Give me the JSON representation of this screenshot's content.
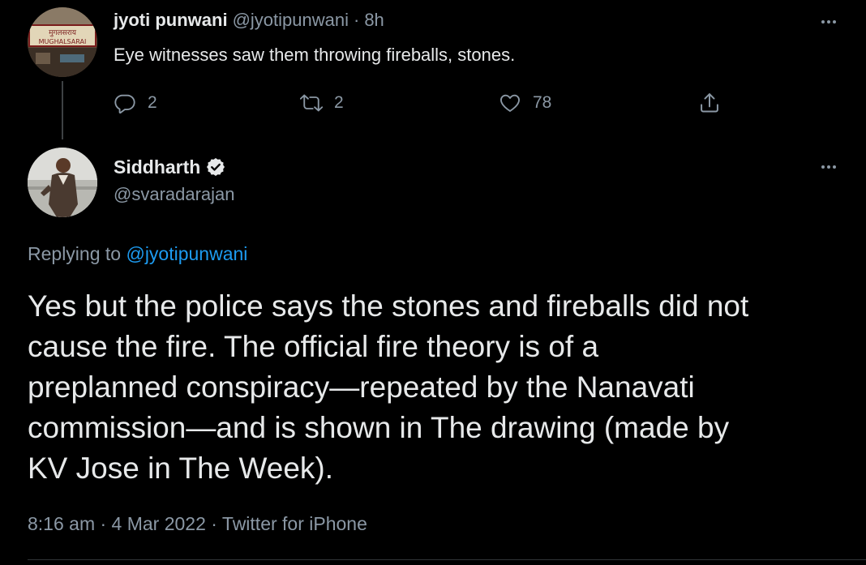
{
  "parent_tweet": {
    "display_name": "jyoti punwani",
    "handle": "@jyotipunwani",
    "separator": "·",
    "time_ago": "8h",
    "text": "Eye witnesses saw them throwing fireballs, stones.",
    "avatar_sign_text": "MUGHALSARAI",
    "actions": {
      "reply": {
        "icon": "reply-icon",
        "count": "2"
      },
      "retweet": {
        "icon": "retweet-icon",
        "count": "2"
      },
      "like": {
        "icon": "heart-icon",
        "count": "78"
      },
      "share": {
        "icon": "share-icon"
      }
    }
  },
  "main_tweet": {
    "display_name": "Siddharth",
    "verified": true,
    "handle": "@svaradarajan",
    "replying_prefix": "Replying to",
    "replying_mention": "@jyotipunwani",
    "body_lines": [
      "Yes but the police says the stones and fireballs did not",
      "cause the fire. The official fire theory is of a",
      "preplanned conspiracy—repeated by the Nanavati",
      "commission—and is shown in The drawing (made by",
      "KV Jose in The Week)."
    ],
    "timestamp": "8:16 am · 4 Mar 2022 · Twitter for iPhone"
  },
  "colors": {
    "background": "#000000",
    "primary_text": "#e7e9ea",
    "secondary_text": "#8b98a5",
    "accent_blue": "#1d9bf0",
    "divider": "#2f3336"
  }
}
